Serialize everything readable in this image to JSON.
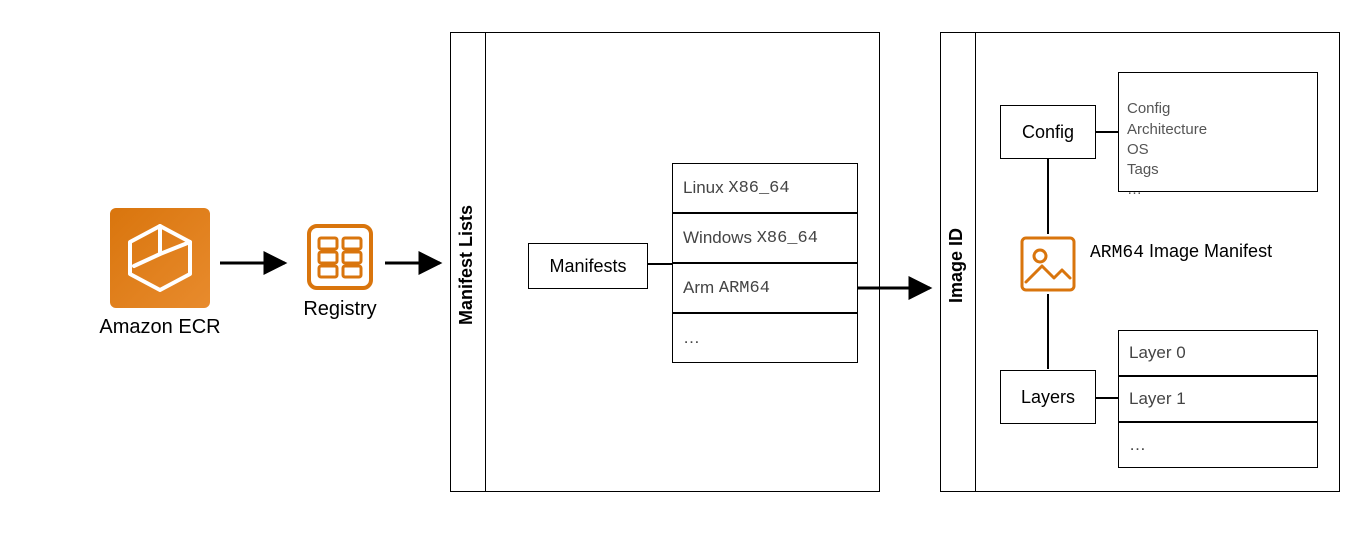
{
  "ecr": {
    "caption": "Amazon ECR"
  },
  "registry": {
    "caption": "Registry"
  },
  "manifest_lists": {
    "side_label": "Manifest Lists",
    "manifests_label": "Manifests",
    "platforms": [
      {
        "os": "Linux",
        "arch": "X86_64"
      },
      {
        "os": "Windows",
        "arch": "X86_64"
      },
      {
        "os": "Arm",
        "arch": "ARM64"
      }
    ],
    "more": "…"
  },
  "image_id": {
    "side_label": "Image ID",
    "config_label": "Config",
    "config_details": "Config\nArchitecture\nOS\nTags\n…",
    "manifest_title_arch": "ARM64",
    "manifest_title_rest": " Image Manifest",
    "layers_label": "Layers",
    "layers": [
      "Layer 0",
      "Layer 1",
      "…"
    ]
  }
}
